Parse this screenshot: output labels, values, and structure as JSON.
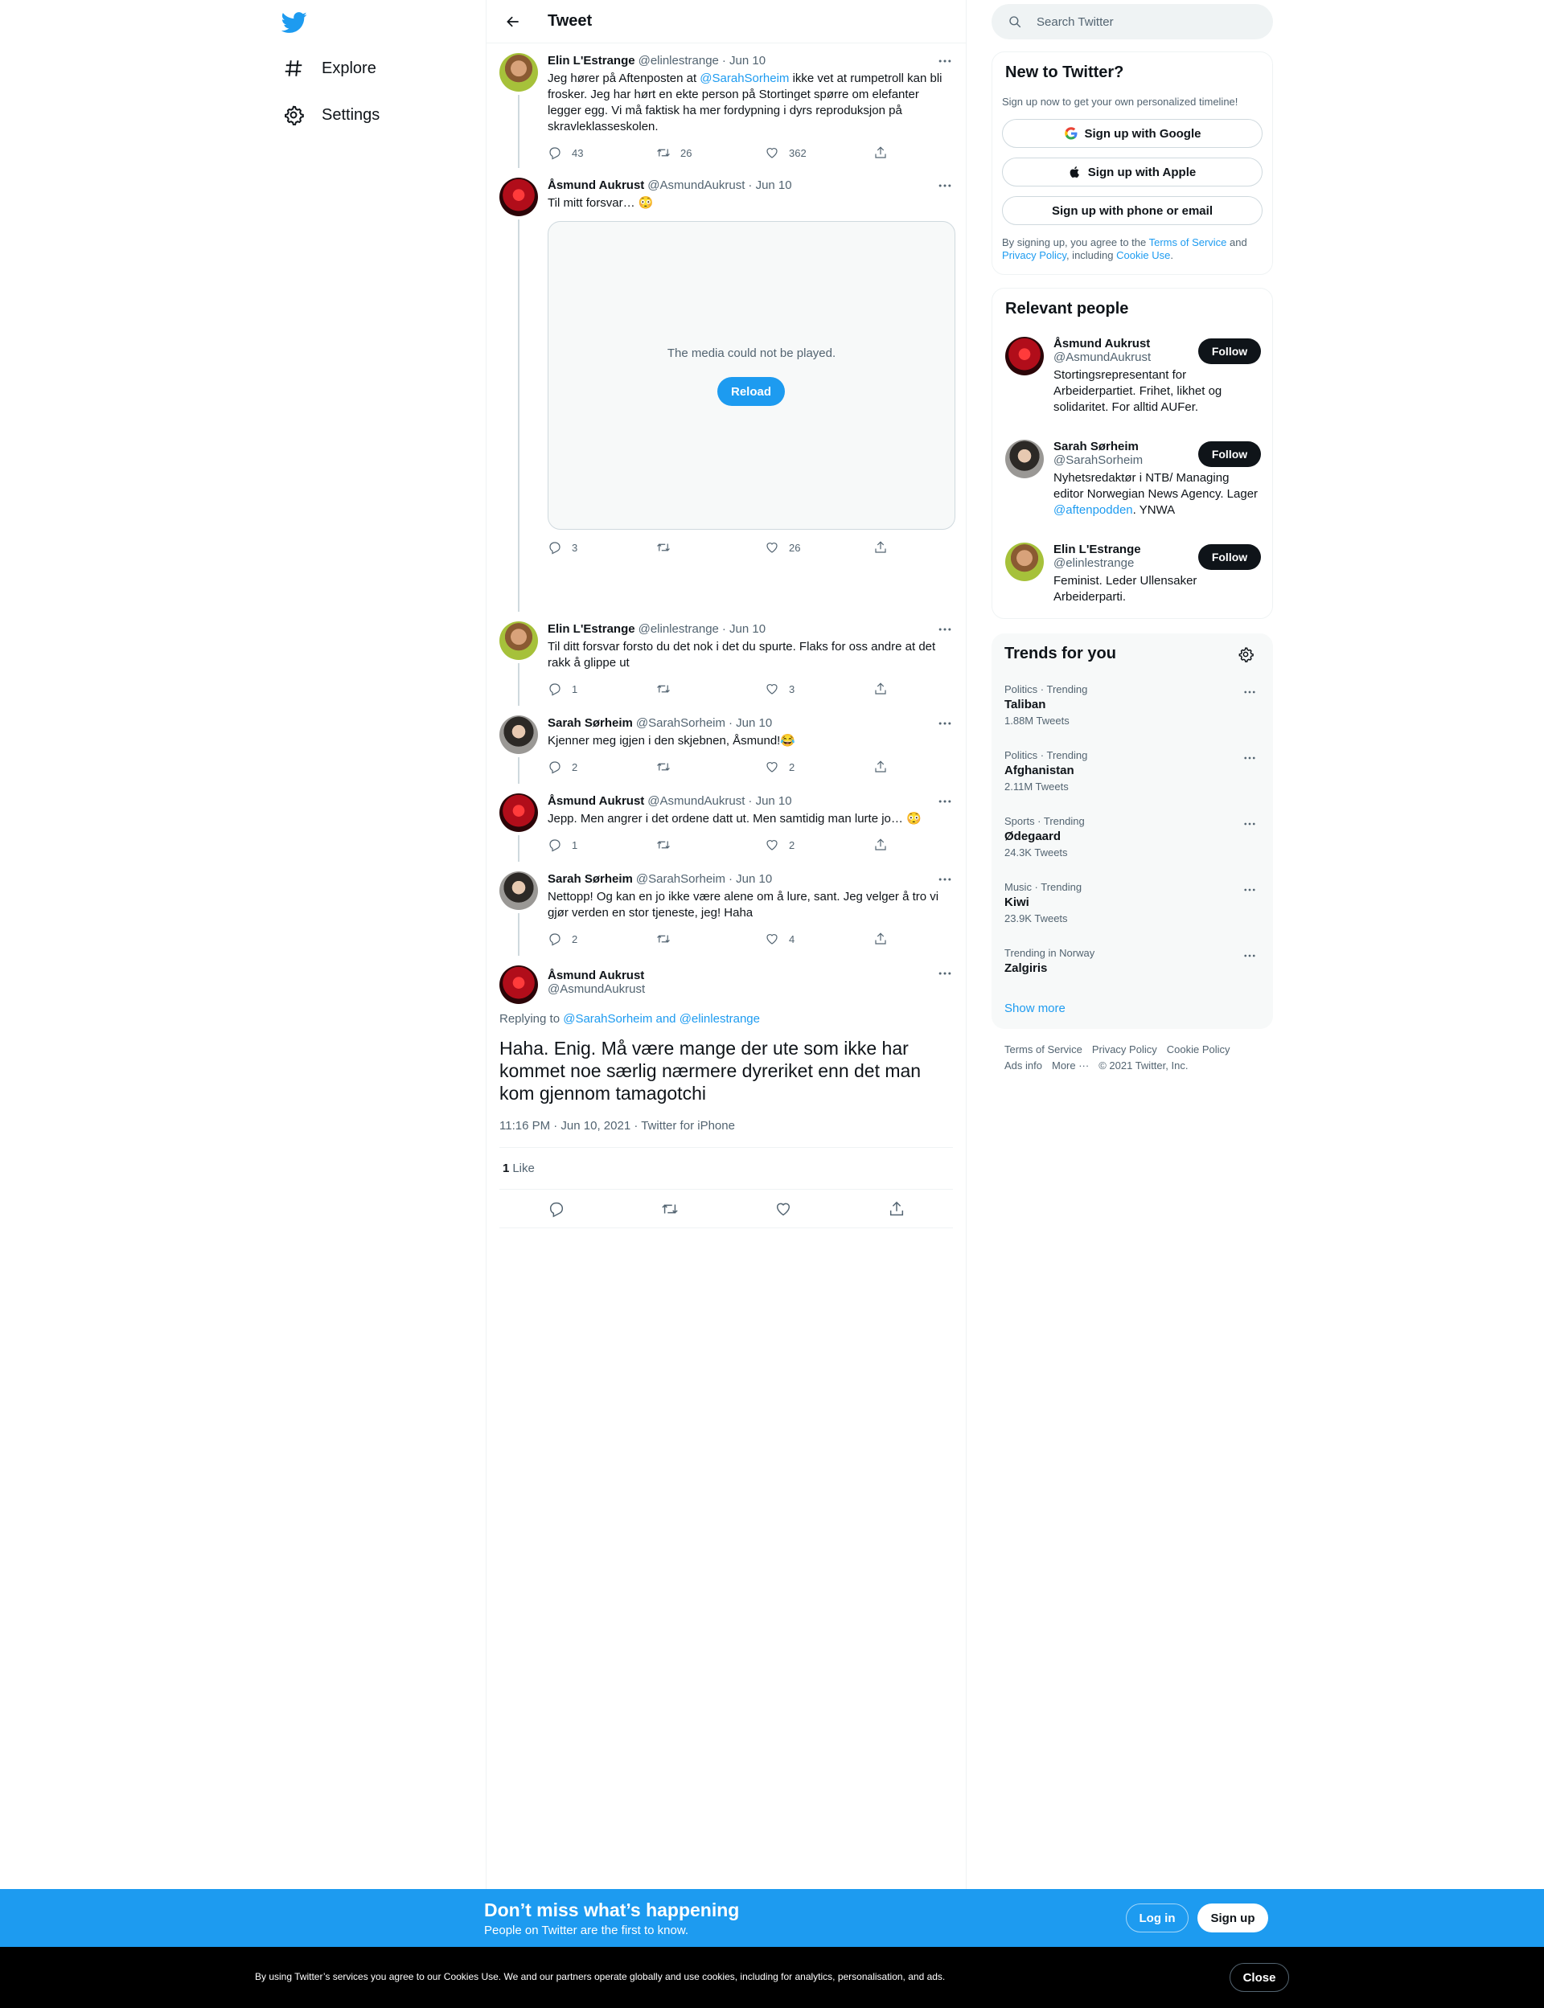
{
  "nav": {
    "items": [
      {
        "label": "Explore",
        "icon": "hashtag-icon"
      },
      {
        "label": "Settings",
        "icon": "gear-icon"
      }
    ]
  },
  "header": {
    "title": "Tweet"
  },
  "tweets": [
    {
      "name": "Elin L'Estrange",
      "handle": "@elinlestrange",
      "date": "· Jun 10",
      "text_before": "Jeg hører på Aftenposten at ",
      "mention": "@SarahSorheim",
      "text_after": " ikke vet at rumpetroll kan bli frosker. Jeg har hørt en ekte person på Stortinget spørre om elefanter legger egg. Vi må faktisk ha mer fordypning i dyrs reproduksjon på skravleklasseskolen.",
      "replies": "43",
      "retweets": "26",
      "likes": "362"
    },
    {
      "name": "Åsmund Aukrust",
      "handle": "@AsmundAukrust",
      "date": "· Jun 10",
      "text": "Til mitt forsvar… 😳",
      "media_message": "The media could not be played.",
      "media_button": "Reload",
      "replies": "3",
      "retweets": "",
      "likes": "26"
    },
    {
      "name": "Elin L'Estrange",
      "handle": "@elinlestrange",
      "date": "· Jun 10",
      "text": "Til ditt forsvar forsto du det nok i det du spurte. Flaks for oss andre at det rakk å glippe ut",
      "replies": "1",
      "retweets": "",
      "likes": "3"
    },
    {
      "name": "Sarah Sørheim",
      "handle": "@SarahSorheim",
      "date": "· Jun 10",
      "text": "Kjenner meg igjen i den skjebnen, Åsmund!😂",
      "replies": "2",
      "retweets": "",
      "likes": "2"
    },
    {
      "name": "Åsmund Aukrust",
      "handle": "@AsmundAukrust",
      "date": "· Jun 10",
      "text": "Jepp. Men angrer i det ordene datt ut. Men samtidig man lurte jo… 😳",
      "replies": "1",
      "retweets": "",
      "likes": "2"
    },
    {
      "name": "Sarah Sørheim",
      "handle": "@SarahSorheim",
      "date": "· Jun 10",
      "text": "Nettopp! Og kan en jo ikke være alene om å lure, sant. Jeg velger å tro vi gjør verden en stor tjeneste, jeg! Haha",
      "replies": "2",
      "retweets": "",
      "likes": "4"
    }
  ],
  "main_tweet": {
    "name": "Åsmund Aukrust",
    "handle": "@AsmundAukrust",
    "replying_prefix": "Replying to ",
    "replying_to": "@SarahSorheim and @elinlestrange",
    "text": "Haha. Enig. Må være mange der ute som ikke har kommet noe særlig nærmere dyreriket enn det man kom gjennom tamagotchi",
    "timestamp": "11:16 PM · Jun 10, 2021 · Twitter for iPhone",
    "like_count": "1",
    "like_label": "Like"
  },
  "search": {
    "placeholder": "Search Twitter"
  },
  "signup": {
    "title": "New to Twitter?",
    "subtitle": "Sign up now to get your own personalized timeline!",
    "google": "Sign up with Google",
    "apple": "Sign up with Apple",
    "phone": "Sign up with phone or email",
    "terms_1": "By signing up, you agree to the ",
    "terms_link1": "Terms of Service",
    "terms_2": " and ",
    "terms_link2": "Privacy Policy",
    "terms_3": ", including ",
    "terms_link3": "Cookie Use",
    "terms_4": "."
  },
  "relevant": {
    "title": "Relevant people",
    "follow_label": "Follow",
    "people": [
      {
        "name": "Åsmund Aukrust",
        "handle": "@AsmundAukrust",
        "bio": "Stortingsrepresentant for Arbeiderpartiet. Frihet, likhet og solidaritet. For alltid AUFer."
      },
      {
        "name": "Sarah Sørheim",
        "handle": "@SarahSorheim",
        "bio_before": "Nyhetsredaktør i NTB/ Managing editor Norwegian News Agency. Lager ",
        "bio_link": "@aftenpodden",
        "bio_after": ". YNWA"
      },
      {
        "name": "Elin L'Estrange",
        "handle": "@elinlestrange",
        "bio": "Feminist. Leder Ullensaker Arbeiderparti."
      }
    ]
  },
  "trends": {
    "title": "Trends for you",
    "items": [
      {
        "context": "Politics · Trending",
        "name": "Taliban",
        "count": "1.88M Tweets"
      },
      {
        "context": "Politics · Trending",
        "name": "Afghanistan",
        "count": "2.11M Tweets"
      },
      {
        "context": "Sports · Trending",
        "name": "Ødegaard",
        "count": "24.3K Tweets"
      },
      {
        "context": "Music · Trending",
        "name": "Kiwi",
        "count": "23.9K Tweets"
      },
      {
        "context": "Trending in Norway",
        "name": "Zalgiris",
        "count": ""
      }
    ],
    "show_more": "Show more"
  },
  "footer": {
    "links": [
      "Terms of Service",
      "Privacy Policy",
      "Cookie Policy",
      "Ads info",
      "More ···"
    ],
    "copyright": "© 2021 Twitter, Inc."
  },
  "banner": {
    "heading": "Don’t miss what’s happening",
    "subheading": "People on Twitter are the first to know.",
    "login": "Log in",
    "signup": "Sign up"
  },
  "cookie": {
    "text": "By using Twitter’s services you agree to our Cookies Use. We and our partners operate globally and use cookies, including for analytics, personalisation, and ads.",
    "close": "Close"
  },
  "colors": {
    "accent": "#1d9bf0",
    "text": "#0f1419",
    "muted": "#536471",
    "banner": "#1d9bf0",
    "cookie_bar": "#000000"
  }
}
